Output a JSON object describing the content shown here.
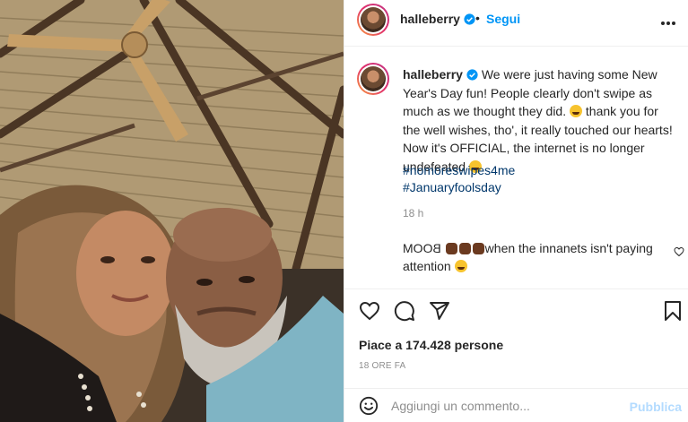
{
  "post": {
    "author": "halleberry",
    "verified": true,
    "header_separator": "•",
    "follow_label": "Segui",
    "caption": "We were just having some New Year's Day fun! People clearly don't swipe as much as we thought they did.",
    "caption_after_emoji": "thank you for the well wishes, tho', it really touched our hearts! Now it's OFFICIAL, the internet is no longer undefeated",
    "hashtags": [
      "#nomoreswipes4me",
      "#Januaryfoolsday"
    ],
    "caption_time": "18 h",
    "comment": {
      "mirrored_word": "BOOM",
      "text": "when the innanets isn't paying attention"
    },
    "likes_text": "Piace a 174.428 persone",
    "posted_ago": "18 ORE FA",
    "comment_placeholder": "Aggiungi un commento...",
    "publish_label": "Pubblica"
  },
  "icons": {
    "header_more": "more-icon",
    "verified": "verified-badge-icon",
    "like": "heart-icon",
    "comment": "comment-icon",
    "share": "share-icon",
    "save": "bookmark-icon",
    "comment_like": "small-heart-icon",
    "emoji": "emoji-icon"
  },
  "colors": {
    "accent": "#0095f6",
    "hashtag": "#00376b",
    "muted": "#8e8e8e",
    "publish_disabled": "#b3dbff"
  }
}
